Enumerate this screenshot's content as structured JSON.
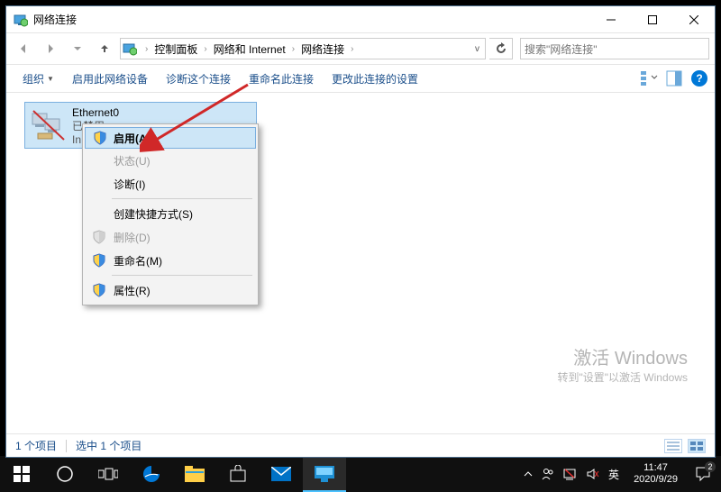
{
  "window": {
    "title": "网络连接",
    "minimize_tip": "最小化",
    "maximize_tip": "最大化",
    "close_tip": "关闭"
  },
  "addressbar": {
    "crumbs": [
      "控制面板",
      "网络和 Internet",
      "网络连接"
    ],
    "search_placeholder": "搜索\"网络连接\""
  },
  "toolbar": {
    "organize": "组织",
    "enable": "启用此网络设备",
    "diagnose": "诊断这个连接",
    "rename": "重命名此连接",
    "change_settings": "更改此连接的设置"
  },
  "adapter": {
    "name": "Ethernet0",
    "status": "已禁用",
    "device_prefix": "In"
  },
  "context_menu": {
    "enable": "启用(A)",
    "status": "状态(U)",
    "diagnose": "诊断(I)",
    "shortcut": "创建快捷方式(S)",
    "delete": "删除(D)",
    "rename": "重命名(M)",
    "properties": "属性(R)"
  },
  "statusbar": {
    "count": "1 个项目",
    "selected": "选中 1 个项目"
  },
  "watermark": {
    "line1": "激活 Windows",
    "line2": "转到\"设置\"以激活 Windows"
  },
  "taskbar": {
    "ime": "英",
    "time": "11:47",
    "date": "2020/9/29",
    "notif_count": "2"
  }
}
